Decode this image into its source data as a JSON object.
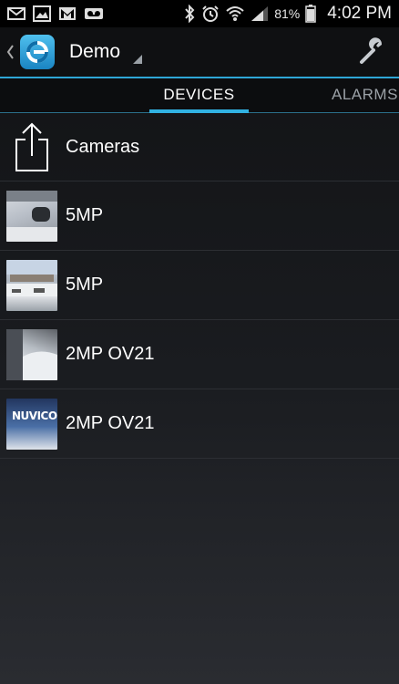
{
  "status_bar": {
    "left_icons": [
      "mail-icon",
      "image-icon",
      "gmail-icon",
      "voicemail-icon"
    ],
    "right_icons": [
      "bluetooth-icon",
      "alarm-icon",
      "wifi-icon",
      "signal-icon",
      "battery-icon"
    ],
    "battery_percent": "81%",
    "time": "4:02 PM"
  },
  "action_bar": {
    "title": "Demo",
    "settings_icon": "wrench-icon",
    "accent_color": "#2ea6d6"
  },
  "tabs": [
    {
      "label": "DEVICES",
      "active": true
    },
    {
      "label": "ALARMS",
      "active": false
    }
  ],
  "list": {
    "header": {
      "label": "Cameras",
      "icon": "share-icon"
    },
    "devices": [
      {
        "label": "5MP",
        "thumbnail": "camera-thumbnail"
      },
      {
        "label": "5MP",
        "thumbnail": "camera-thumbnail"
      },
      {
        "label": "2MP OV21",
        "thumbnail": "camera-thumbnail"
      },
      {
        "label": "2MP OV21",
        "thumbnail": "camera-thumbnail",
        "thumbnail_text": "NUVICO"
      }
    ]
  }
}
